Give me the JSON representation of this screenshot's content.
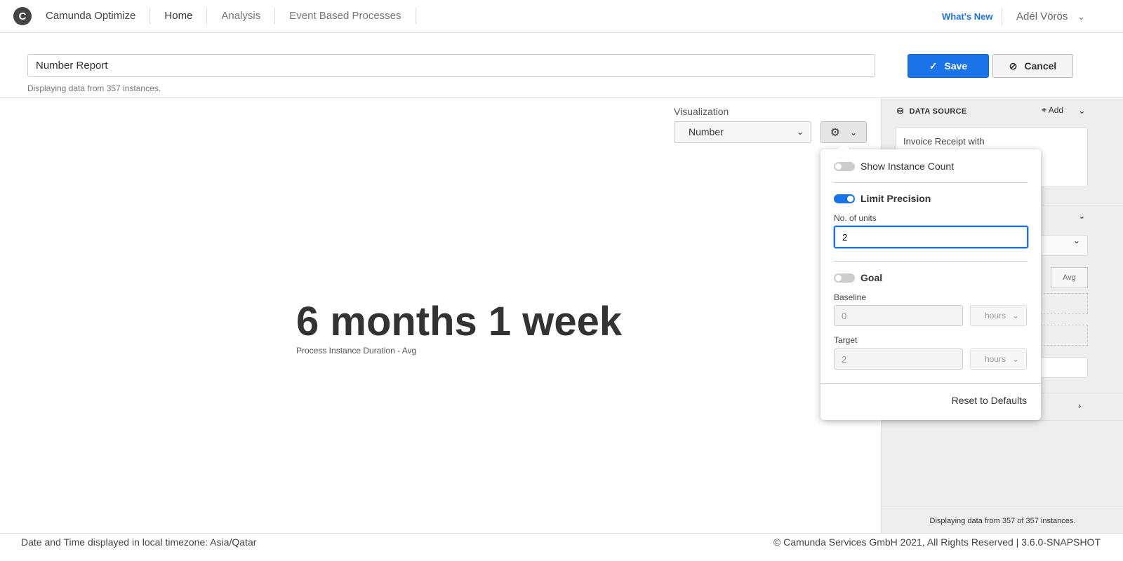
{
  "header": {
    "logo": "C",
    "brand": "Camunda Optimize",
    "nav": [
      "Home",
      "Analysis",
      "Event Based Processes"
    ],
    "whats_new": "What's New",
    "user": "Adél Vörös"
  },
  "report": {
    "title": "Number Report",
    "subtitle": "Displaying data from 357 instances.",
    "save": "Save",
    "cancel": "Cancel"
  },
  "visualization": {
    "label": "Visualization",
    "value": "Number"
  },
  "result": {
    "value": "6 months 1 week",
    "label": "Process Instance Duration - Avg"
  },
  "popover": {
    "show_instance_count": "Show Instance Count",
    "show_instance_count_on": false,
    "limit_precision": "Limit Precision",
    "limit_precision_on": true,
    "units_label": "No. of units",
    "units_value": "2",
    "goal": "Goal",
    "goal_on": false,
    "baseline_label": "Baseline",
    "baseline_value": "0",
    "baseline_unit": "hours",
    "target_label": "Target",
    "target_value": "2",
    "target_unit": "hours",
    "reset": "Reset to Defaults"
  },
  "sidebar": {
    "data_source": "DATA SOURCE",
    "add": "Add",
    "process": "Invoice Receipt with",
    "avg": "Avg",
    "footer": "Displaying data from 357 of 357 instances."
  },
  "footer": {
    "timezone": "Date and Time displayed in local timezone: Asia/Qatar",
    "copyright": "© Camunda Services GmbH 2021, All Rights Reserved | 3.6.0-SNAPSHOT"
  },
  "colors": {
    "accent": "#1a73e8"
  }
}
